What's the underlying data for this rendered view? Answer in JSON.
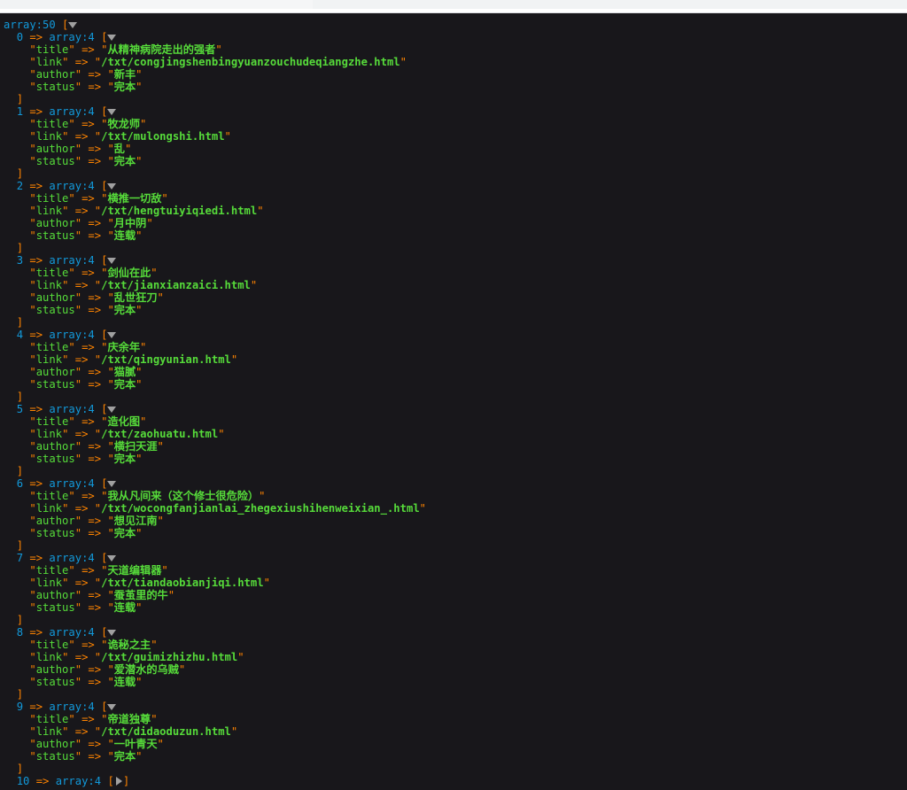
{
  "browser": {
    "tab_strip_visible": true
  },
  "dump": {
    "root_label": "array:50",
    "open_bracket": "[",
    "close_bracket": "]",
    "arrow": "=>",
    "quote": "\"",
    "item_label": "array:4",
    "toggle_open_icon": "triangle-down-icon",
    "toggle_closed_icon": "triangle-right-icon",
    "keys": [
      "title",
      "link",
      "author",
      "status"
    ],
    "colors": {
      "background": "#18171B",
      "note": "#1299DA",
      "punct": "#FF8400",
      "key": "#56DB3A",
      "string": "#56DB3A",
      "toggle": "#A0A0A0"
    },
    "entries": [
      {
        "index": "0",
        "expanded": true,
        "title": "从精神病院走出的强者",
        "link": "/txt/congjingshenbingyuanzouchudeqiangzhe.html",
        "author": "新丰",
        "status": "完本"
      },
      {
        "index": "1",
        "expanded": true,
        "title": "牧龙师",
        "link": "/txt/mulongshi.html",
        "author": "乱",
        "status": "完本"
      },
      {
        "index": "2",
        "expanded": true,
        "title": "横推一切敌",
        "link": "/txt/hengtuiyiqiedi.html",
        "author": "月中阴",
        "status": "连载"
      },
      {
        "index": "3",
        "expanded": true,
        "title": "剑仙在此",
        "link": "/txt/jianxianzaici.html",
        "author": "乱世狂刀",
        "status": "完本"
      },
      {
        "index": "4",
        "expanded": true,
        "title": "庆余年",
        "link": "/txt/qingyunian.html",
        "author": "猫腻",
        "status": "完本"
      },
      {
        "index": "5",
        "expanded": true,
        "title": "造化图",
        "link": "/txt/zaohuatu.html",
        "author": "横扫天涯",
        "status": "完本"
      },
      {
        "index": "6",
        "expanded": true,
        "title": "我从凡间来（这个修士很危险）",
        "link": "/txt/wocongfanjianlai_zhegexiushihenweixian_.html",
        "author": "想见江南",
        "status": "完本"
      },
      {
        "index": "7",
        "expanded": true,
        "title": "天道编辑器",
        "link": "/txt/tiandaobianjiqi.html",
        "author": "蚕茧里的牛",
        "status": "连载"
      },
      {
        "index": "8",
        "expanded": true,
        "title": "诡秘之主",
        "link": "/txt/guimizhizhu.html",
        "author": "爱潜水的乌贼",
        "status": "连载"
      },
      {
        "index": "9",
        "expanded": true,
        "title": "帝道独尊",
        "link": "/txt/didaoduzun.html",
        "author": "一叶青天",
        "status": "完本"
      },
      {
        "index": "10",
        "expanded": false,
        "title": null,
        "link": null,
        "author": null,
        "status": null
      }
    ]
  }
}
